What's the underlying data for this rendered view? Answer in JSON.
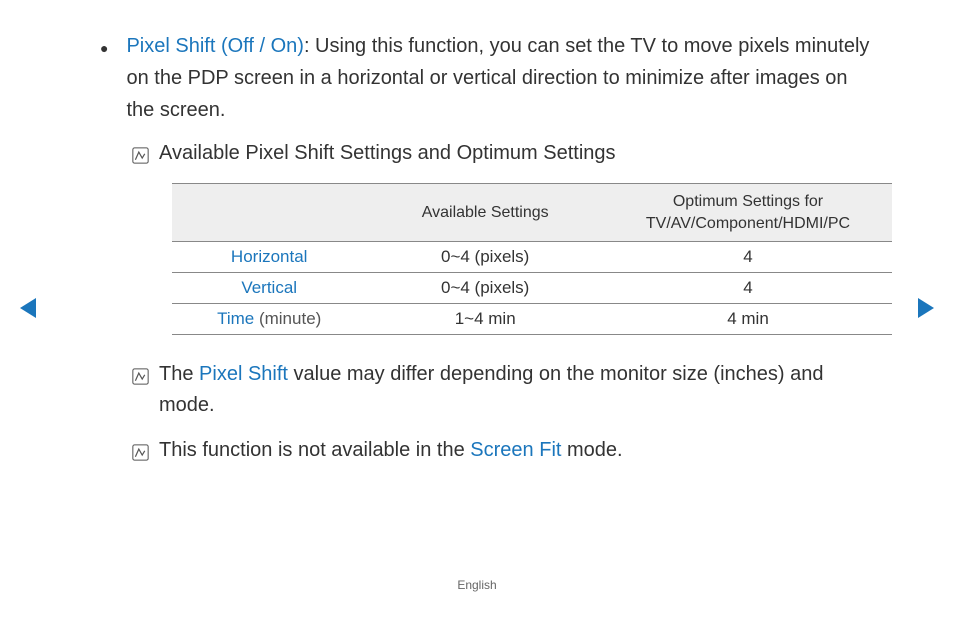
{
  "bullet": {
    "title": "Pixel Shift (Off / On)",
    "desc": ": Using this function, you can set the TV to move pixels minutely on the PDP screen in a horizontal or vertical direction to minimize after images on the screen."
  },
  "notes": {
    "n1": "Available Pixel Shift Settings and Optimum Settings",
    "n2_pre": "The ",
    "n2_link": "Pixel Shift",
    "n2_post": " value may differ depending on the monitor size (inches) and mode.",
    "n3_pre": "This function is not available in the ",
    "n3_link": "Screen Fit",
    "n3_post": " mode."
  },
  "table": {
    "headers": {
      "h0": "",
      "h1": "Available Settings",
      "h2": "Optimum Settings for TV/AV/Component/HDMI/PC"
    },
    "rows": [
      {
        "label": "Horizontal",
        "sub": "",
        "c1": "0~4 (pixels)",
        "c2": "4"
      },
      {
        "label": "Vertical",
        "sub": "",
        "c1": "0~4 (pixels)",
        "c2": "4"
      },
      {
        "label": "Time",
        "sub": " (minute)",
        "c1": "1~4 min",
        "c2": "4 min"
      }
    ]
  },
  "footer": {
    "lang": "English"
  },
  "chart_data": {
    "type": "table",
    "title": "Available Pixel Shift Settings and Optimum Settings",
    "columns": [
      "",
      "Available Settings",
      "Optimum Settings for TV/AV/Component/HDMI/PC"
    ],
    "rows": [
      [
        "Horizontal",
        "0~4 (pixels)",
        "4"
      ],
      [
        "Vertical",
        "0~4 (pixels)",
        "4"
      ],
      [
        "Time (minute)",
        "1~4 min",
        "4 min"
      ]
    ]
  }
}
